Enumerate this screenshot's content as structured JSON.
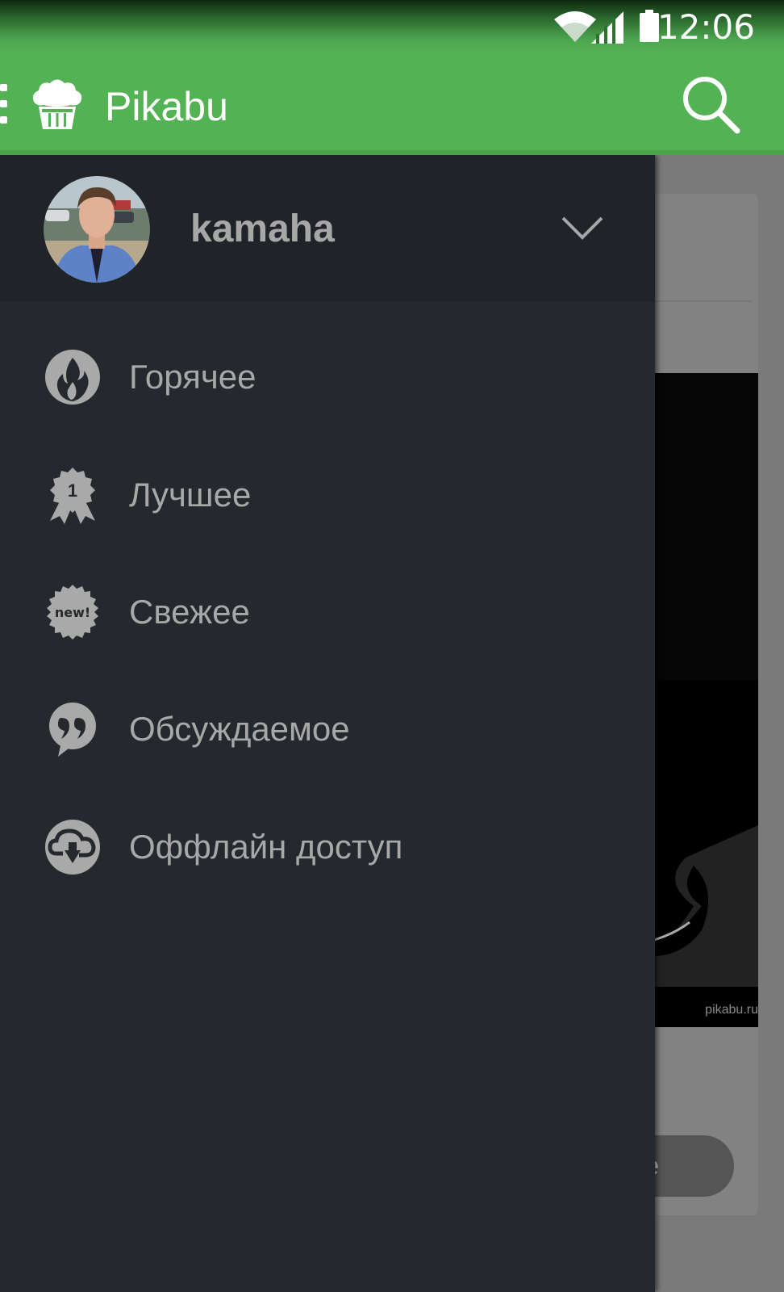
{
  "status_bar": {
    "time": "12:06",
    "icons": [
      "wifi-icon",
      "signal-icon",
      "battery-icon"
    ]
  },
  "app_bar": {
    "title": "Pikabu",
    "logo_icon": "cupcake-logo-icon",
    "search_icon": "search-icon",
    "menu_icon": "menu-icon",
    "color": "#53b254"
  },
  "drawer": {
    "username": "kamaha",
    "toggle_icon": "chevron-down-icon",
    "items": [
      {
        "label": "Горячее",
        "icon": "fire-icon"
      },
      {
        "label": "Лучшее",
        "icon": "award-ribbon-icon",
        "badge": "1"
      },
      {
        "label": "Свежее",
        "icon": "new-badge-icon",
        "badge": "new!"
      },
      {
        "label": "Обсуждаемое",
        "icon": "quote-bubble-icon"
      },
      {
        "label": "Оффлайн доступ",
        "icon": "cloud-download-icon"
      }
    ],
    "background": "#25282c",
    "header_background": "#202327"
  },
  "background_content": {
    "watermark": "pikabu.ru",
    "share_label": "are"
  }
}
